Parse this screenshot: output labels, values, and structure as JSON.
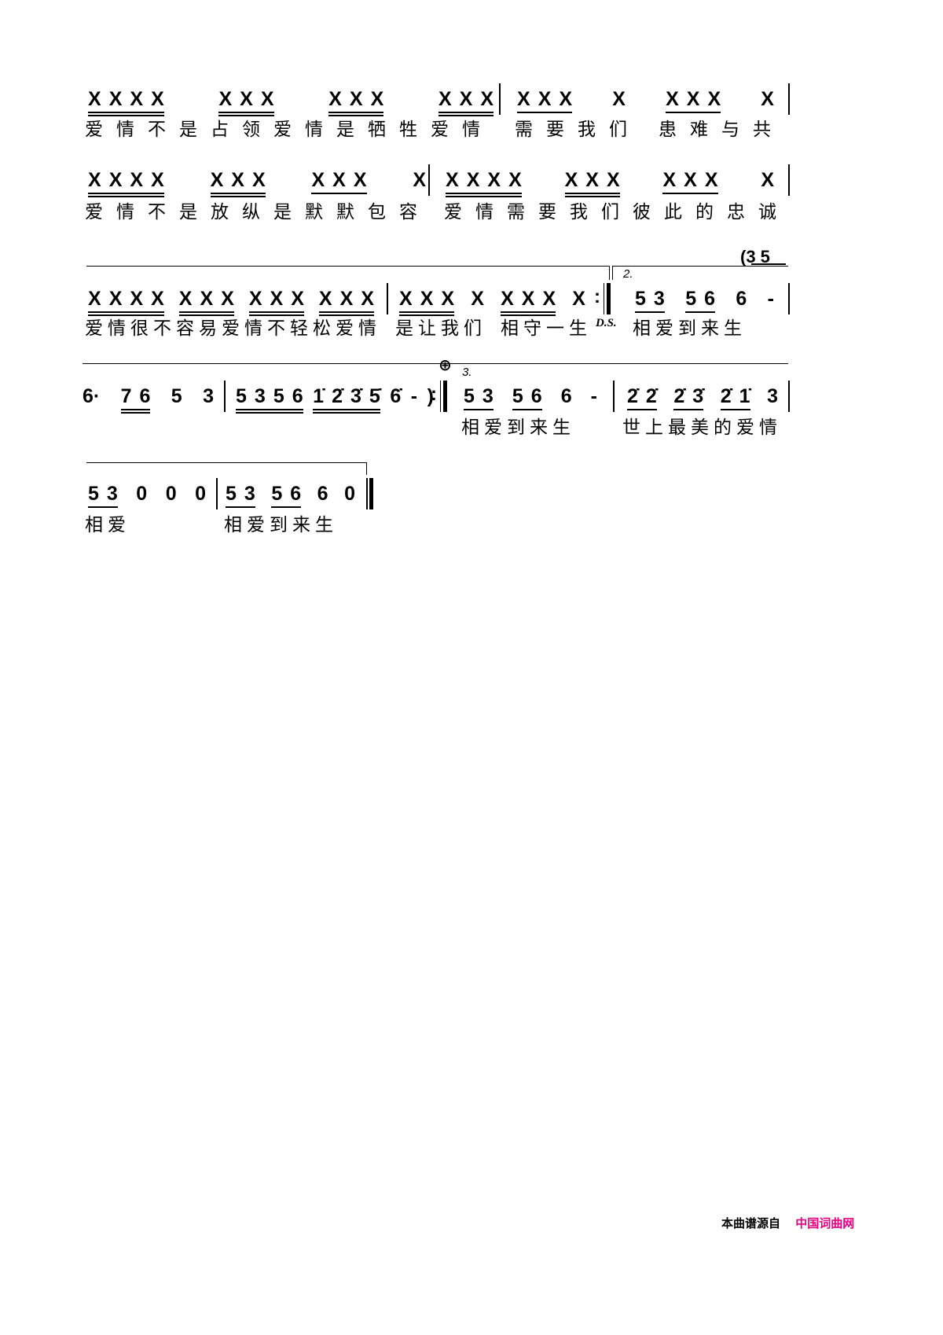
{
  "rows": [
    {
      "measures": [
        {
          "groups": [
            {
              "n": [
                "X",
                "X",
                "X",
                "X"
              ],
              "u": 2
            },
            {
              "n": [
                "X",
                "X",
                "X"
              ],
              "u": 2
            },
            {
              "n": [
                "X",
                "X",
                "X"
              ],
              "u": 2
            },
            {
              "n": [
                "X",
                "X",
                "X"
              ],
              "u": 2
            }
          ],
          "bar": "|"
        },
        {
          "groups": [
            {
              "n": [
                "X",
                "X",
                "X"
              ],
              "u": 1
            },
            {
              "n": [
                "X"
              ],
              "u": 0
            },
            {
              "n": [
                "X",
                "X",
                "X"
              ],
              "u": 1
            },
            {
              "n": [
                "X"
              ],
              "u": 0
            }
          ],
          "bar": "|"
        }
      ],
      "lyrics": [
        "爱情不是占领爱情是牺牲爱情",
        "需要我们",
        "患难与共"
      ]
    },
    {
      "measures": [
        {
          "groups": [
            {
              "n": [
                "X",
                "X",
                "X",
                "X"
              ],
              "u": 2
            },
            {
              "n": [
                "X",
                "X",
                "X"
              ],
              "u": 2
            },
            {
              "n": [
                "X",
                "X",
                "X"
              ],
              "u": 1
            },
            {
              "n": [
                "X"
              ],
              "u": 0
            }
          ],
          "bar": "|"
        },
        {
          "groups": [
            {
              "n": [
                "X",
                "X",
                "X",
                "X"
              ],
              "u": 2
            },
            {
              "n": [
                "X",
                "X",
                "X"
              ],
              "u": 2
            },
            {
              "n": [
                "X",
                "X",
                "X"
              ],
              "u": 1
            },
            {
              "n": [
                "X"
              ],
              "u": 0
            }
          ],
          "bar": "|"
        }
      ],
      "lyrics": [
        "爱情不是放纵是默默包容",
        "爱情需要我们彼此的忠诚"
      ]
    },
    {
      "measures": [
        {
          "groups": [
            {
              "n": [
                "X",
                "X",
                "X",
                "X"
              ],
              "u": 2
            },
            {
              "n": [
                "X",
                "X",
                "X"
              ],
              "u": 2
            },
            {
              "n": [
                "X",
                "X",
                "X"
              ],
              "u": 2
            },
            {
              "n": [
                "X",
                "X",
                "X"
              ],
              "u": 2
            }
          ],
          "bar": "|"
        },
        {
          "groups": [
            {
              "n": [
                "X",
                "X",
                "X"
              ],
              "u": 2
            },
            {
              "n": [
                "X"
              ],
              "u": 0
            },
            {
              "n": [
                "X",
                "X",
                "X"
              ],
              "u": 2
            },
            {
              "n": [
                "X"
              ],
              "u": 0
            }
          ],
          "bar": ":‖"
        },
        {
          "groups": [
            {
              "n": [
                "5",
                "3"
              ],
              "u": 1
            },
            {
              "n": [
                "5",
                "6"
              ],
              "u": 1
            },
            {
              "n": [
                "6"
              ],
              "u": 0
            },
            {
              "n": [
                "-"
              ],
              "u": 0
            }
          ],
          "bar": "|"
        }
      ],
      "lyrics": [
        "爱情很不容易爱情不轻松爱情",
        "是让我们",
        "相守一生",
        "相爱到来生"
      ],
      "ds": "D.S.",
      "volta": "2.",
      "intro": "(3 5"
    },
    {
      "measures": [
        {
          "groups": [
            {
              "n": [
                "6·"
              ],
              "u": 0
            },
            {
              "n": [
                "7",
                "6"
              ],
              "u": 2
            },
            {
              "n": [
                "5"
              ],
              "u": 0
            },
            {
              "n": [
                "3"
              ],
              "u": 0
            }
          ],
          "bar": "|"
        },
        {
          "groups": [
            {
              "n": [
                "5",
                "3",
                "5",
                "6"
              ],
              "u": 2
            },
            {
              "n": [
                "1̇",
                "2̇",
                "3̇",
                "5̇"
              ],
              "u": 2
            },
            {
              "n": [
                "6̇"
              ],
              "u": 0
            },
            {
              "n": [
                "-"
              ],
              "u": 0
            },
            {
              "n": [
                ")"
              ],
              "u": 0
            }
          ],
          "bar": ":‖"
        },
        {
          "groups": [
            {
              "n": [
                "5",
                "3"
              ],
              "u": 1
            },
            {
              "n": [
                "5",
                "6"
              ],
              "u": 1
            },
            {
              "n": [
                "6"
              ],
              "u": 0
            },
            {
              "n": [
                "-"
              ],
              "u": 0
            }
          ],
          "bar": "|"
        },
        {
          "groups": [
            {
              "n": [
                "2̇",
                "2̇"
              ],
              "u": 1
            },
            {
              "n": [
                "2̇",
                "3̇"
              ],
              "u": 1
            },
            {
              "n": [
                "2̇",
                "1̇"
              ],
              "u": 1
            },
            {
              "n": [
                "3"
              ],
              "u": 0
            }
          ],
          "bar": "|"
        }
      ],
      "lyrics": [
        "相爱到来生",
        "世上最美的爱情"
      ],
      "volta": "3.",
      "coda": "coda-sign"
    },
    {
      "measures": [
        {
          "groups": [
            {
              "n": [
                "5",
                "3"
              ],
              "u": 1
            },
            {
              "n": [
                "0"
              ],
              "u": 0
            },
            {
              "n": [
                "0"
              ],
              "u": 0
            },
            {
              "n": [
                "0"
              ],
              "u": 0
            }
          ],
          "bar": "|"
        },
        {
          "groups": [
            {
              "n": [
                "5",
                "3"
              ],
              "u": 1
            },
            {
              "n": [
                "5",
                "6"
              ],
              "u": 1
            },
            {
              "n": [
                "6"
              ],
              "u": 0
            },
            {
              "n": [
                "0"
              ],
              "u": 0
            }
          ],
          "bar": "‖"
        }
      ],
      "lyrics": [
        "相爱",
        "相爱到来生"
      ]
    }
  ],
  "footer": {
    "source_label": "本曲谱源自",
    "site_name": "中国词曲网",
    "site_color": "#e4007f"
  }
}
